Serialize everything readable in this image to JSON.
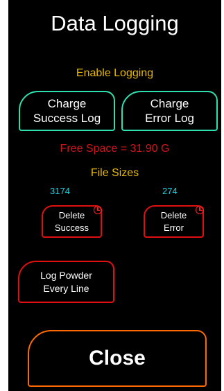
{
  "title": "Data Logging",
  "enable_logging": {
    "label": "Enable Logging",
    "success_button": "Charge\nSuccess Log",
    "error_button": "Charge\nError Log"
  },
  "free_space": "Free Space = 31.90 G",
  "file_sizes": {
    "label": "File Sizes",
    "success_size": "3174",
    "error_size": "274",
    "delete_success_button": "Delete\nSuccess",
    "delete_error_button": "Delete\nError"
  },
  "log_powder_button": "Log Powder\nEvery Line",
  "close_button": "Close",
  "colors": {
    "background": "#000000",
    "section_label": "#e6b800",
    "free_space": "#d0141c",
    "size_value": "#19d6e6",
    "button_border_green": "#2ee0b0",
    "button_border_red": "#e01010",
    "button_border_orange": "#ff6a00"
  },
  "icons": {
    "delete_timer": "clock-icon"
  }
}
